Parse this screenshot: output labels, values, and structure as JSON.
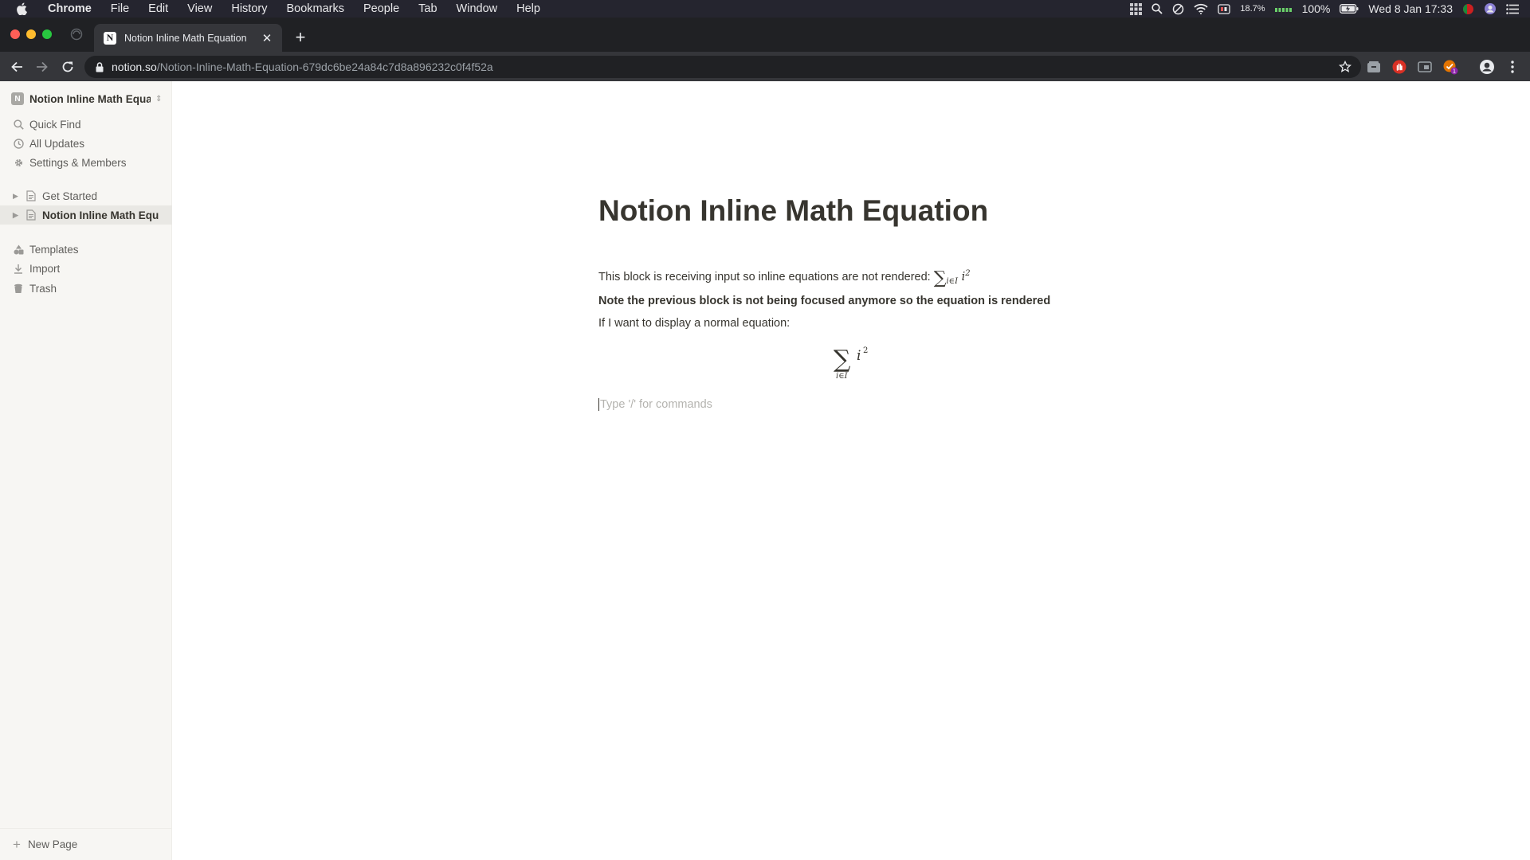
{
  "menubar": {
    "app": "Chrome",
    "items": [
      "File",
      "Edit",
      "View",
      "History",
      "Bookmarks",
      "People",
      "Tab",
      "Window",
      "Help"
    ],
    "cpu": "18.7%",
    "battery": "100%",
    "clock": "Wed 8 Jan  17:33"
  },
  "browser": {
    "tab_title": "Notion Inline Math Equation",
    "url_host": "notion.so",
    "url_path": "/Notion-Inline-Math-Equation-679dc6be24a84c7d8a896232c0f4f52a",
    "extension_badge": "1"
  },
  "sidebar": {
    "workspace_initial": "N",
    "workspace_name": "Notion Inline Math Equat...",
    "quick_find": "Quick Find",
    "all_updates": "All Updates",
    "settings": "Settings & Members",
    "pages": [
      "Get Started",
      "Notion Inline Math Equ..."
    ],
    "templates": "Templates",
    "import": "Import",
    "trash": "Trash",
    "new_page": "New Page"
  },
  "content": {
    "title": "Notion Inline Math Equation",
    "block1": "This block is receiving input so inline equations are not rendered:",
    "block2": "Note the previous block is not being focused anymore so the equation is rendered",
    "block3": "If I want to display a normal equation:",
    "placeholder": "Type '/' for commands",
    "eq_sum": "∑",
    "eq_sub": "i∈I",
    "eq_base": "i",
    "eq_sup": "2"
  },
  "colors": {
    "menubar_bg": "#25252f",
    "tabstrip_bg": "#202124",
    "toolbar_bg": "#35363a",
    "sidebar_bg": "#f7f6f3",
    "text": "#37352f",
    "placeholder": "#b4b3af"
  }
}
